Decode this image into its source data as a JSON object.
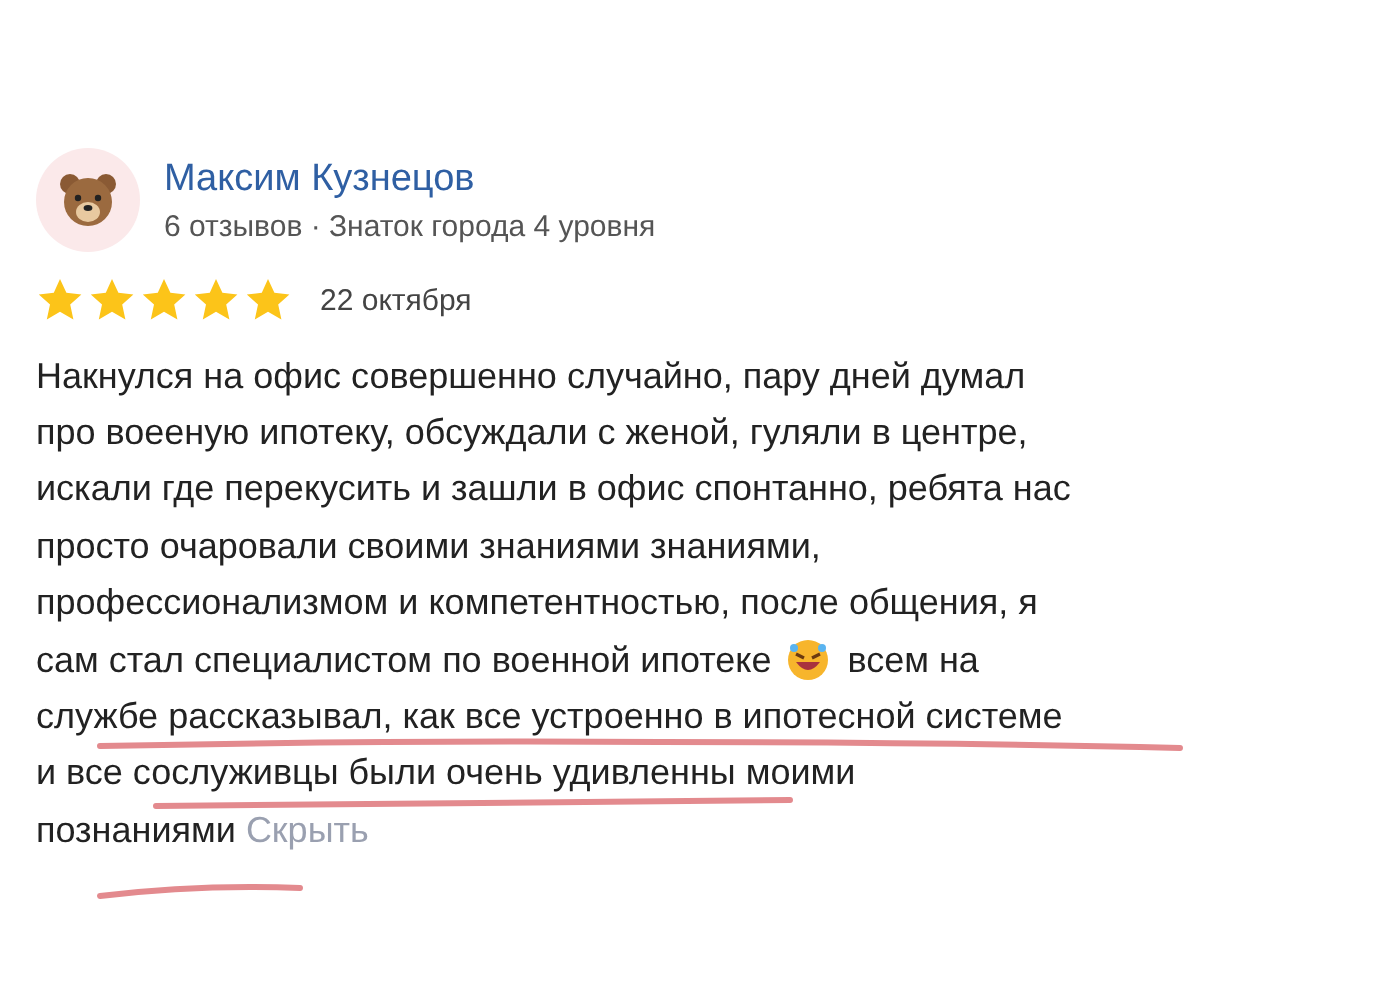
{
  "review": {
    "author": "Максим Кузнецов",
    "meta": "6 отзывов · Знаток города 4 уровня",
    "stars": 5,
    "date": "22 октября",
    "lines": [
      {
        "text": "Накнулся на офис совершенно случайно, пару дней думал"
      },
      {
        "text": "про воееную ипотеку, обсуждали с женой, гуляли в центре,"
      },
      {
        "text": "искали где перекусить и зашли в офис спонтанно, ребята нас"
      },
      {
        "text": "просто очаровали своими знаниями знаниями,"
      },
      {
        "text": "профессионализмом и компетентностью, после общения, я"
      },
      {
        "text": "сам стал специалистом по военной ипотеке",
        "after_emoji": "всем на"
      },
      {
        "text": "службе рассказывал, как все устроенно в ипотесной системе"
      },
      {
        "text": "и все сослуживцы были очень удивленны моими"
      },
      {
        "text": "познаниями",
        "link": "Скрыть"
      }
    ]
  }
}
